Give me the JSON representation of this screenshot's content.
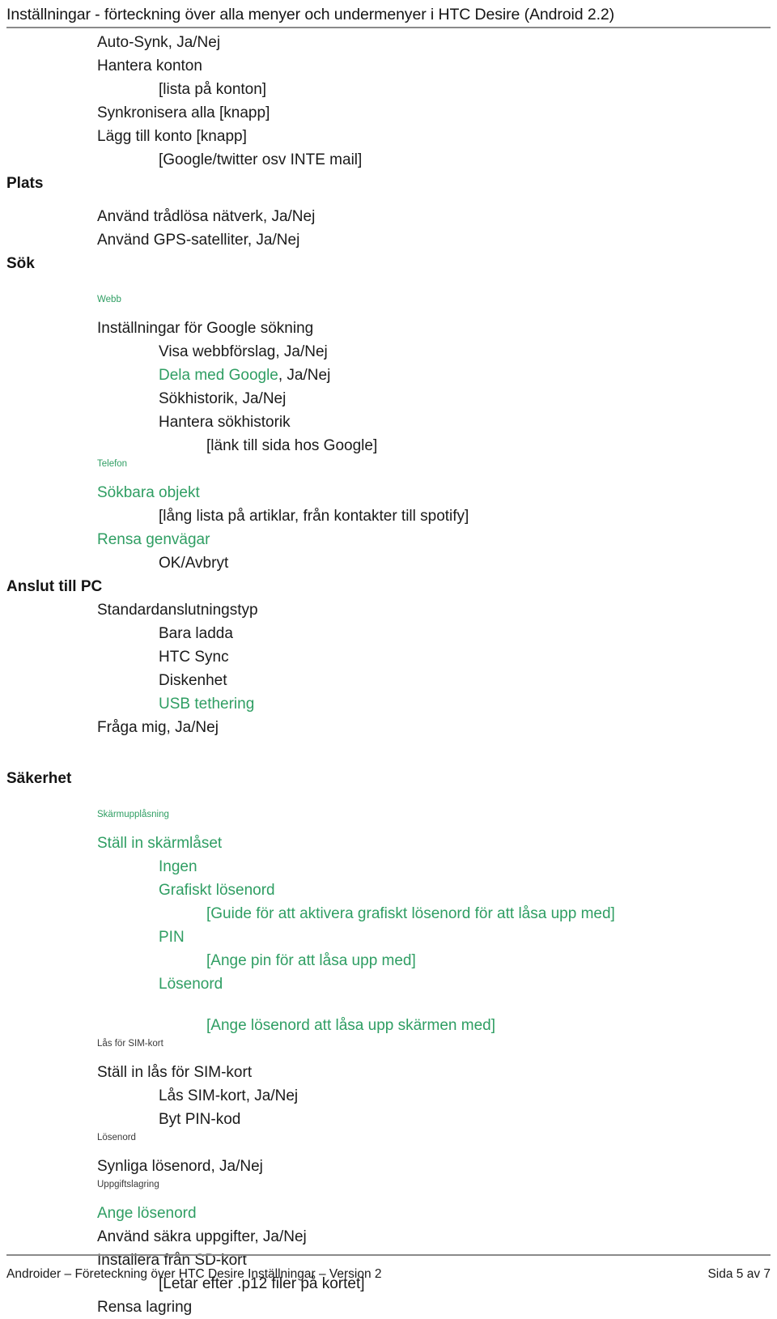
{
  "header": {
    "title": "Inställningar - förteckning över alla menyer och undermenyer i HTC Desire (Android 2.2)"
  },
  "footer": {
    "left": "Androider – Företeckning över HTC Desire Inställningar – Version 2",
    "right": "Sida 5 av 7"
  },
  "colors": {
    "green": "#2f9e63",
    "text": "#1a1a1a",
    "rule": "#8a8a8a"
  },
  "lines": {
    "auto_synk": "Auto-Synk, Ja/Nej",
    "hantera_konton": "Hantera konton",
    "lista_pa_konton": "[lista på konton]",
    "synkronisera_alla": "Synkronisera alla [knapp]",
    "lagg_till_konto": "Lägg till konto [knapp]",
    "google_twitter": "[Google/twitter osv INTE mail]",
    "plats": "Plats",
    "anvand_tradlosa": "Använd trådlösa nätverk, Ja/Nej",
    "anvand_gps": "Använd GPS-satelliter, Ja/Nej",
    "sok": "Sök",
    "webb_label": "Webb",
    "installningar_google": "Inställningar för Google sökning",
    "visa_webbforslag": "Visa webbförslag, Ja/Nej",
    "dela_med_google_green": "Dela med Google",
    "dela_med_google_rest": ", Ja/Nej",
    "sokhistorik": "Sökhistorik, Ja/Nej",
    "hantera_sokhistorik": "Hantera sökhistorik",
    "lank_google": "[länk till sida hos Google]",
    "telefon_label": "Telefon",
    "sokbara_objekt": "Sökbara objekt",
    "lang_lista": "[lång lista på artiklar, från kontakter till spotify]",
    "rensa_genvagar": "Rensa genvägar",
    "ok_avbryt": "OK/Avbryt",
    "anslut_till_pc": "Anslut till PC",
    "standardanslutningstyp": "Standardanslutningstyp",
    "bara_ladda": "Bara ladda",
    "htc_sync": "HTC Sync",
    "diskenhet": "Diskenhet",
    "usb_tethering": "USB tethering",
    "fraga_mig": "Fråga mig, Ja/Nej",
    "sakerhet": "Säkerhet",
    "skarmupplasning_label": "Skärmupplåsning",
    "stall_in_skarmlaset": "Ställ in skärmlåset",
    "ingen": "Ingen",
    "grafiskt_losenord": "Grafiskt lösenord",
    "guide_grafiskt": "[Guide för att aktivera grafiskt lösenord för att låsa upp med]",
    "pin": "PIN",
    "ange_pin": "[Ange pin för att låsa upp med]",
    "losenord_opt": "Lösenord",
    "ange_losenord_skarm": "[Ange lösenord att låsa upp skärmen med]",
    "las_for_simkort_label": "Lås för SIM-kort",
    "stall_in_las_simkort": "Ställ in lås för SIM-kort",
    "las_simkort": "Lås SIM-kort, Ja/Nej",
    "byt_pinkod": "Byt PIN-kod",
    "losenord_label": "Lösenord",
    "synliga_losenord": "Synliga lösenord, Ja/Nej",
    "uppgiftslagring_label": "Uppgiftslagring",
    "ange_losenord": "Ange lösenord",
    "anvand_sakra": "Använd säkra uppgifter, Ja/Nej",
    "installera_sdkort": "Installera från SD-kort",
    "letar_efter_p12": "[Letar efter .p12 filer på kortet]",
    "rensa_lagring": "Rensa lagring"
  }
}
